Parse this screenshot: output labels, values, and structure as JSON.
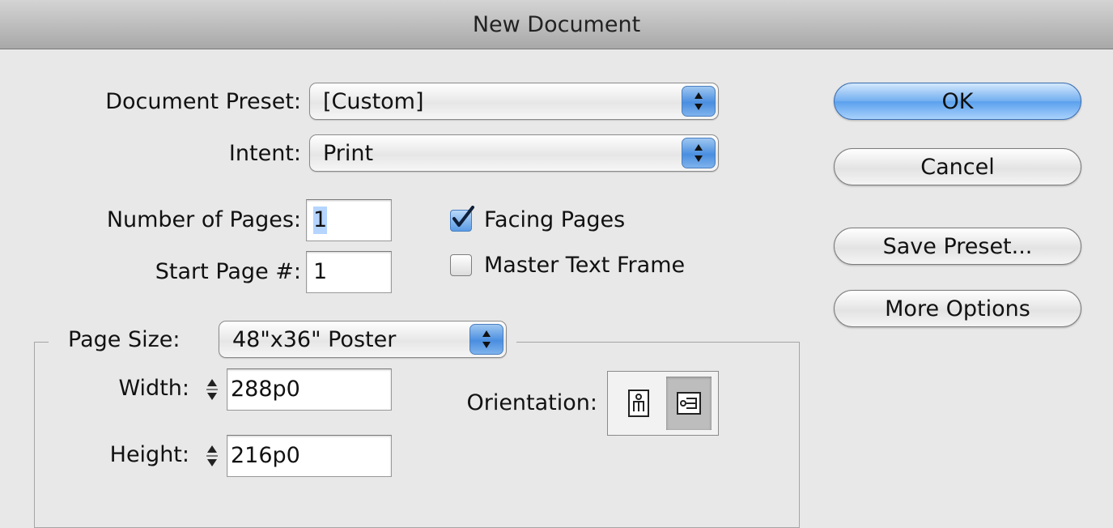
{
  "window": {
    "title": "New Document"
  },
  "form": {
    "document_preset_label": "Document Preset:",
    "document_preset_value": "[Custom]",
    "intent_label": "Intent:",
    "intent_value": "Print",
    "number_of_pages_label": "Number of Pages:",
    "number_of_pages_value": "1",
    "start_page_label": "Start Page #:",
    "start_page_value": "1",
    "facing_pages_label": "Facing Pages",
    "facing_pages_checked": true,
    "master_text_frame_label": "Master Text Frame",
    "master_text_frame_checked": false
  },
  "page_size": {
    "label": "Page Size:",
    "value": "48\"x36\" Poster",
    "width_label": "Width:",
    "width_value": "288p0",
    "height_label": "Height:",
    "height_value": "216p0",
    "orientation_label": "Orientation:",
    "orientation_selected": "landscape"
  },
  "buttons": {
    "ok": "OK",
    "cancel": "Cancel",
    "save_preset": "Save Preset...",
    "more_options": "More Options"
  },
  "icons": {
    "popup_arrows": "up-down-arrows-icon",
    "stepper": "stepper-arrows-icon",
    "portrait": "portrait-orientation-icon",
    "landscape": "landscape-orientation-icon",
    "check": "checkmark-icon"
  },
  "colors": {
    "accent_blue": "#5aa0ee",
    "dialog_bg": "#e8e8e8",
    "selection_highlight": "#b5d5ff"
  }
}
